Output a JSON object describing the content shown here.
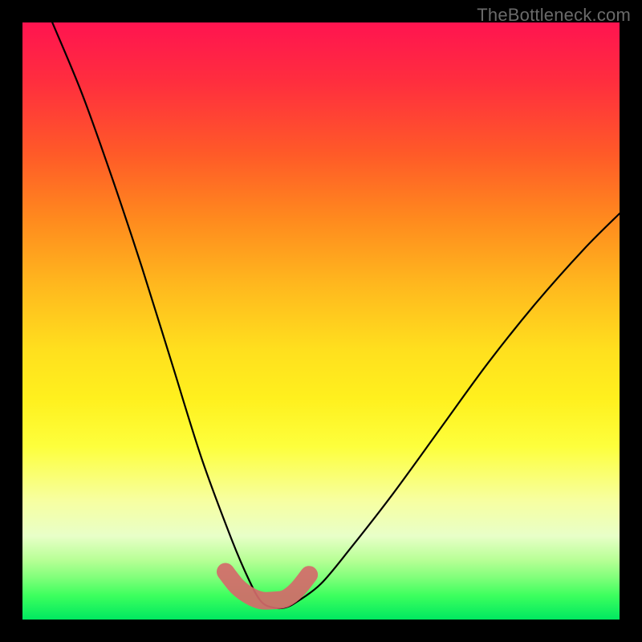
{
  "watermark": "TheBottleneck.com",
  "chart_data": {
    "type": "line",
    "title": "",
    "xlabel": "",
    "ylabel": "",
    "xlim": [
      0,
      100
    ],
    "ylim": [
      0,
      100
    ],
    "series": [
      {
        "name": "bottleneck-curve",
        "x": [
          5,
          10,
          15,
          20,
          25,
          30,
          35,
          38,
          40,
          42,
          44,
          46,
          50,
          55,
          62,
          70,
          78,
          86,
          94,
          100
        ],
        "values": [
          100,
          88,
          74,
          59,
          43,
          27,
          13.5,
          6.5,
          3,
          2,
          2,
          3,
          6,
          12,
          21,
          32,
          43,
          53,
          62,
          68
        ]
      },
      {
        "name": "highlight-segment",
        "x": [
          34,
          36,
          38,
          40,
          42,
          44,
          46,
          48
        ],
        "values": [
          8,
          5.5,
          4,
          3.2,
          3.2,
          3.5,
          5,
          7.5
        ]
      }
    ],
    "gradient_stops": [
      {
        "pos": 0,
        "color": "#ff1450"
      },
      {
        "pos": 10,
        "color": "#ff2e3e"
      },
      {
        "pos": 22,
        "color": "#ff5a28"
      },
      {
        "pos": 33,
        "color": "#ff8a1e"
      },
      {
        "pos": 44,
        "color": "#ffb81e"
      },
      {
        "pos": 55,
        "color": "#ffe01e"
      },
      {
        "pos": 63,
        "color": "#fff01e"
      },
      {
        "pos": 71,
        "color": "#fdff3c"
      },
      {
        "pos": 80,
        "color": "#f7ffa0"
      },
      {
        "pos": 86,
        "color": "#e8ffc8"
      },
      {
        "pos": 90,
        "color": "#b8ff96"
      },
      {
        "pos": 93,
        "color": "#80ff7a"
      },
      {
        "pos": 96,
        "color": "#3cff5e"
      },
      {
        "pos": 100,
        "color": "#00e860"
      }
    ]
  }
}
